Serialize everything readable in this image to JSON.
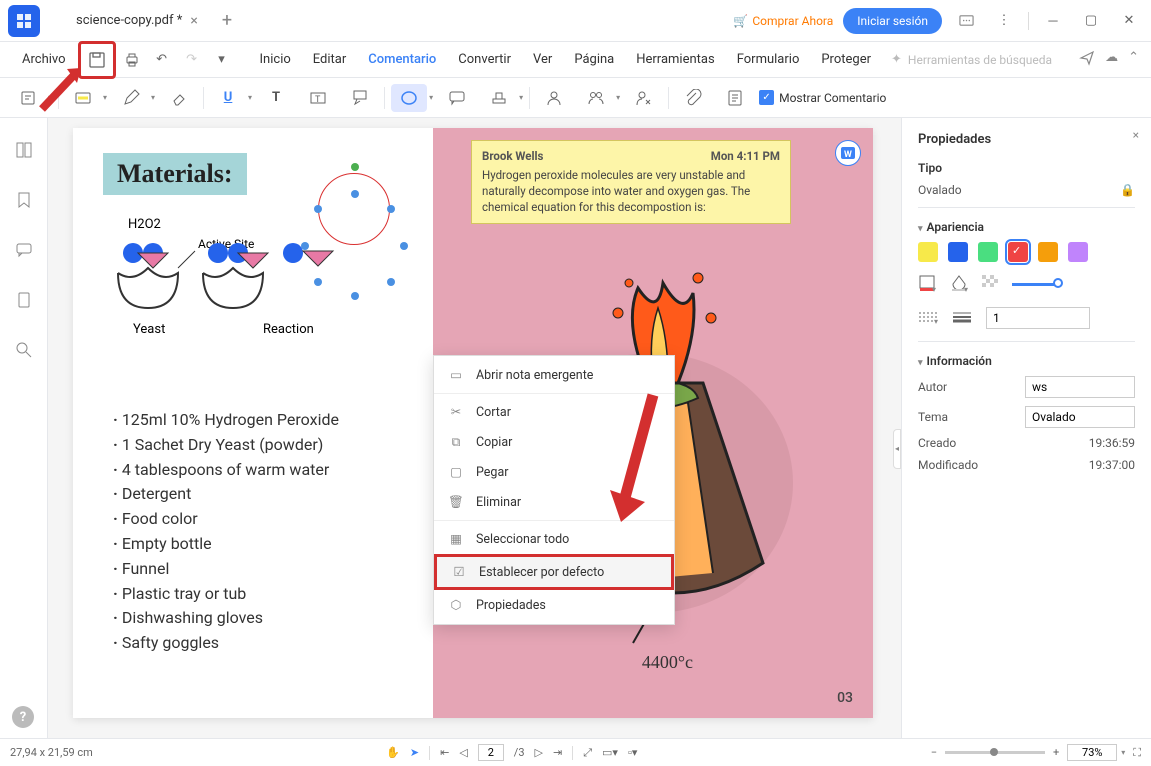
{
  "titlebar": {
    "tab_name": "science-copy.pdf *",
    "buy_now": "Comprar Ahora",
    "login": "Iniciar sesión"
  },
  "menubar": {
    "file": "Archivo",
    "items": [
      "Inicio",
      "Editar",
      "Comentario",
      "Convertir",
      "Ver",
      "Página",
      "Herramientas",
      "Formulario",
      "Proteger"
    ],
    "search_placeholder": "Herramientas de búsqueda"
  },
  "toolbar": {
    "show_comment": "Mostrar Comentario"
  },
  "page_content": {
    "materials_title": "Materials:",
    "h2o2_label": "H2O2",
    "active_site": "Active Site",
    "yeast_label": "Yeast",
    "reaction_label": "Reaction",
    "ingredients": [
      "125ml 10% Hydrogen Peroxide",
      "1 Sachet Dry Yeast (powder)",
      "4 tablespoons of warm water",
      "Detergent",
      "Food color",
      "Empty bottle",
      "Funnel",
      "Plastic tray or tub",
      "Dishwashing gloves",
      "Safty goggles"
    ],
    "temperature": "4400°c",
    "page_number": "03"
  },
  "note": {
    "author": "Brook Wells",
    "time": "Mon 4:11 PM",
    "body": "Hydrogen peroxide molecules are very unstable and naturally decompose into water and oxygen gas. The chemical equation for this decompostion is:"
  },
  "context_menu": {
    "items": [
      {
        "icon": "note",
        "label": "Abrir nota emergente"
      },
      {
        "icon": "cut",
        "label": "Cortar"
      },
      {
        "icon": "copy",
        "label": "Copiar"
      },
      {
        "icon": "paste",
        "label": "Pegar"
      },
      {
        "icon": "delete",
        "label": "Eliminar"
      },
      {
        "icon": "select",
        "label": "Seleccionar todo"
      },
      {
        "icon": "default",
        "label": "Establecer por defecto"
      },
      {
        "icon": "props",
        "label": "Propiedades"
      }
    ]
  },
  "properties": {
    "header": "Propiedades",
    "type_label": "Tipo",
    "type_value": "Ovalado",
    "appearance_label": "Apariencia",
    "colors": [
      "#f7e94a",
      "#2563eb",
      "#4ade80",
      "#ef4444",
      "#f59e0b",
      "#c084fc"
    ],
    "active_color_index": 3,
    "opacity_value": "1",
    "info_label": "Información",
    "author_label": "Autor",
    "author_value": "ws",
    "theme_label": "Tema",
    "theme_value": "Ovalado",
    "created_label": "Creado",
    "created_value": "19:36:59",
    "modified_label": "Modificado",
    "modified_value": "19:37:00"
  },
  "statusbar": {
    "dimensions": "27,94 x 21,59 cm",
    "current_page": "2",
    "total_pages": "/3",
    "zoom": "73%"
  }
}
